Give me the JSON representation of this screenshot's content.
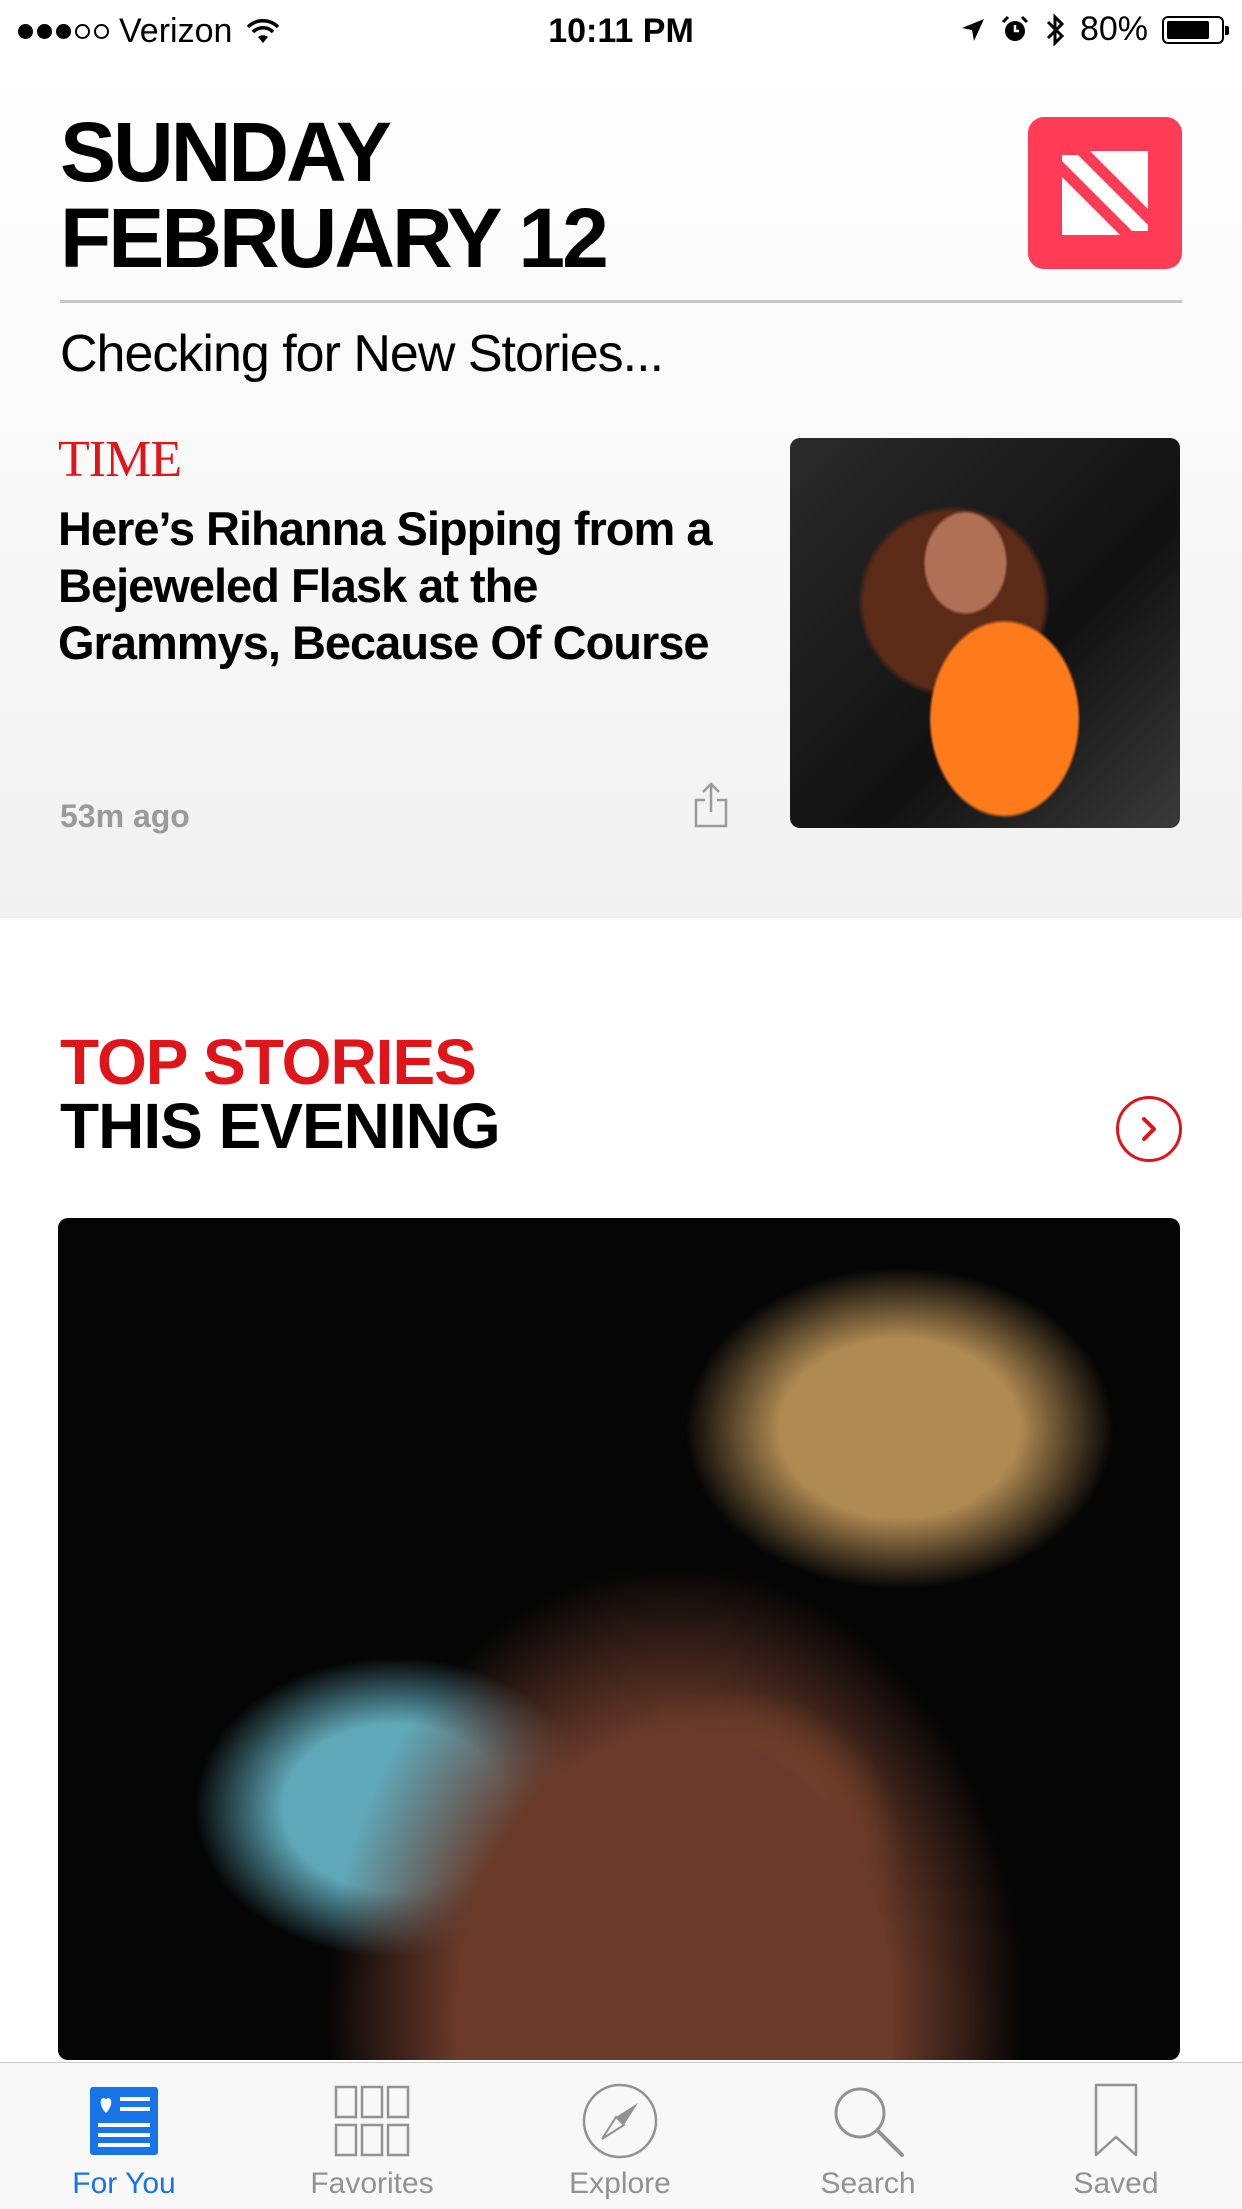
{
  "status_bar": {
    "carrier": "Verizon",
    "time": "10:11 PM",
    "battery": "80%",
    "signal_bars_filled": 3,
    "signal_bars_total": 5
  },
  "header": {
    "day": "SUNDAY",
    "date": "FEBRUARY 12",
    "status_text": "Checking for New Stories..."
  },
  "featured_story": {
    "source": "TIME",
    "headline": "Here’s Rihanna Sipping from a Bejeweled Flask at the Grammys, Because Of Course",
    "timestamp": "53m ago"
  },
  "section": {
    "title_line1": "TOP STORIES",
    "title_line2": "THIS EVENING"
  },
  "tabs": [
    {
      "label": "For You",
      "icon": "for-you-icon",
      "active": true
    },
    {
      "label": "Favorites",
      "icon": "favorites-grid-icon",
      "active": false
    },
    {
      "label": "Explore",
      "icon": "compass-icon",
      "active": false
    },
    {
      "label": "Search",
      "icon": "search-icon",
      "active": false
    },
    {
      "label": "Saved",
      "icon": "bookmark-icon",
      "active": false
    }
  ],
  "colors": {
    "accent_red": "#e0151a",
    "tab_active": "#1673e8",
    "badge_pink": "#ff3b55"
  }
}
